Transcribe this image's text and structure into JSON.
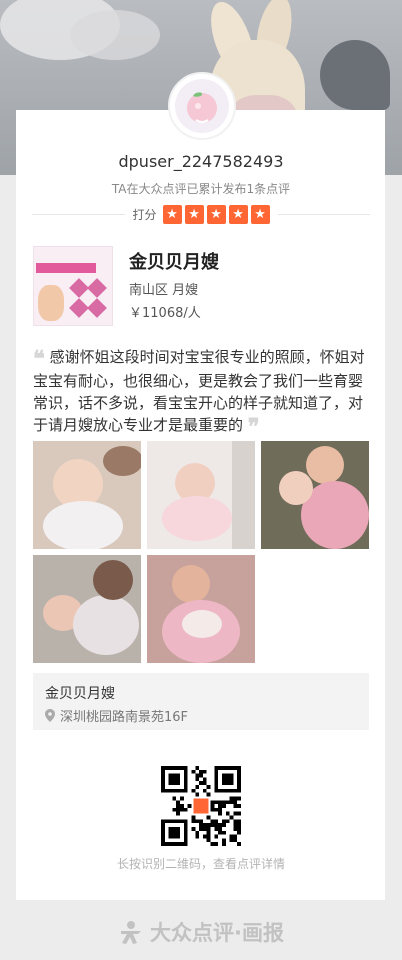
{
  "profile": {
    "username": "dpuser_2247582493",
    "summary": "TA在大众点评已累计发布1条点评",
    "rating_label": "打分",
    "stars": 5
  },
  "shop": {
    "name": "金贝贝月嫂",
    "area": "南山区 月嫂",
    "price": "￥11068/人"
  },
  "review": {
    "text": "感谢怀姐这段时间对宝宝很专业的照顾，怀姐对宝宝有耐心，也很细心，更是教会了我们一些育婴常识，话不多说，看宝宝开心的样子就知道了，对于请月嫂放心专业才是最重要的"
  },
  "photos": [
    {
      "name": "photo-1"
    },
    {
      "name": "photo-2"
    },
    {
      "name": "photo-3"
    },
    {
      "name": "photo-4"
    },
    {
      "name": "photo-5"
    }
  ],
  "location": {
    "name": "金贝贝月嫂",
    "address": "深圳桃园路南景苑16F"
  },
  "qr": {
    "hint": "长按识别二维码，查看点评详情"
  },
  "footer": {
    "brand": "大众点评·画报"
  },
  "colors": {
    "star": "#ff6633",
    "card": "#ffffff",
    "page_bg": "#ececec"
  }
}
